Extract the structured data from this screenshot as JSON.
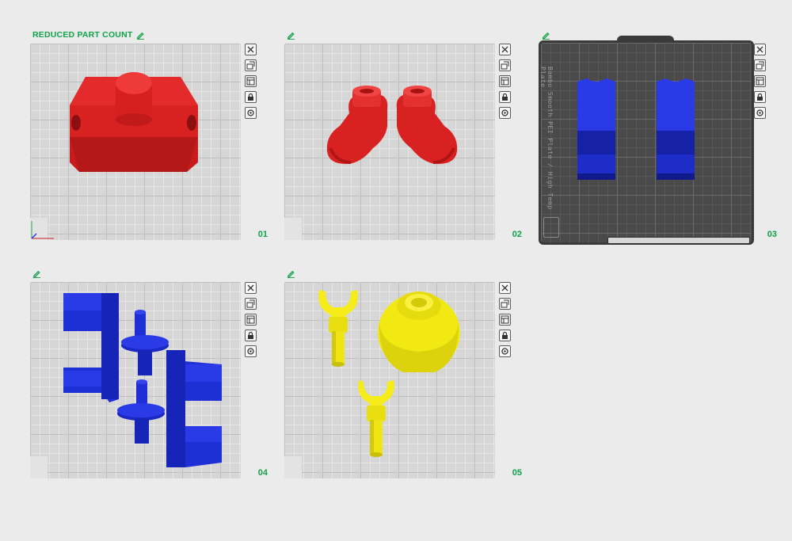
{
  "plates": [
    {
      "number": "01",
      "title": "REDUCED PART COUNT",
      "color": "#e02424",
      "bed": "light"
    },
    {
      "number": "02",
      "title": "",
      "color": "#e02424",
      "bed": "light"
    },
    {
      "number": "03",
      "title": "",
      "color": "#1f2fd6",
      "bed": "dark",
      "bed_text": "Bambu Smooth PEI Plate / High Temp Plate"
    },
    {
      "number": "04",
      "title": "",
      "color": "#1f2fd6",
      "bed": "light"
    },
    {
      "number": "05",
      "title": "",
      "color": "#f5ec1a",
      "bed": "light"
    }
  ],
  "toolbar": [
    "close-icon",
    "auto-orient-icon",
    "arrange-icon",
    "lock-icon",
    "settings-icon"
  ],
  "colors": {
    "accent": "#12a24a",
    "red": "#e02424",
    "blue": "#1f2fd6",
    "yellow": "#f5ec1a"
  }
}
